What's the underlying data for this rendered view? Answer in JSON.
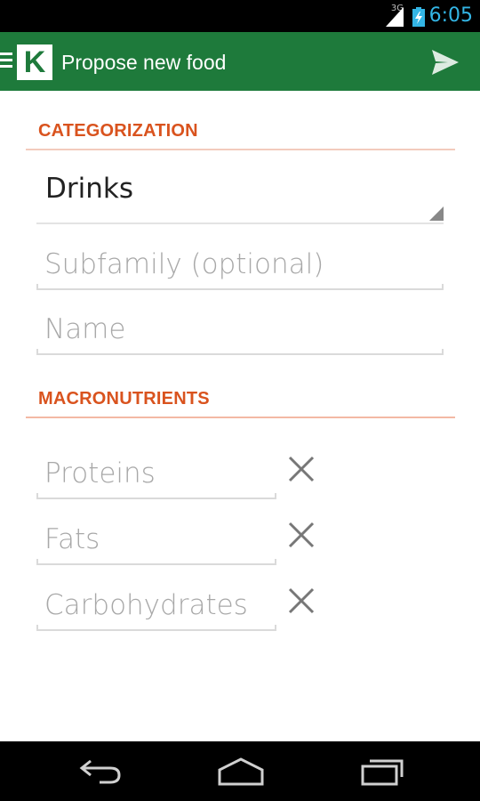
{
  "status_bar": {
    "network": "3G",
    "time": "6:05"
  },
  "app_bar": {
    "logo_letter": "K",
    "title": "Propose new food",
    "icons": {
      "menu": "menu-icon",
      "send": "send-icon"
    }
  },
  "categorization": {
    "header": "CATEGORIZATION",
    "family_selected": "Drinks",
    "subfamily_placeholder": "Subfamily (optional)",
    "subfamily_value": "",
    "name_placeholder": "Name",
    "name_value": ""
  },
  "macronutrients": {
    "header": "MACRONUTRIENTS",
    "fields": [
      {
        "placeholder": "Proteins",
        "value": ""
      },
      {
        "placeholder": "Fats",
        "value": ""
      },
      {
        "placeholder": "Carbohydrates",
        "value": ""
      }
    ]
  },
  "nav_bar": {
    "icons": [
      "back-icon",
      "home-icon",
      "recent-apps-icon"
    ]
  },
  "colors": {
    "app_bar": "#1e7a3b",
    "section_header": "#d9531e",
    "status_time": "#33b5e5"
  }
}
